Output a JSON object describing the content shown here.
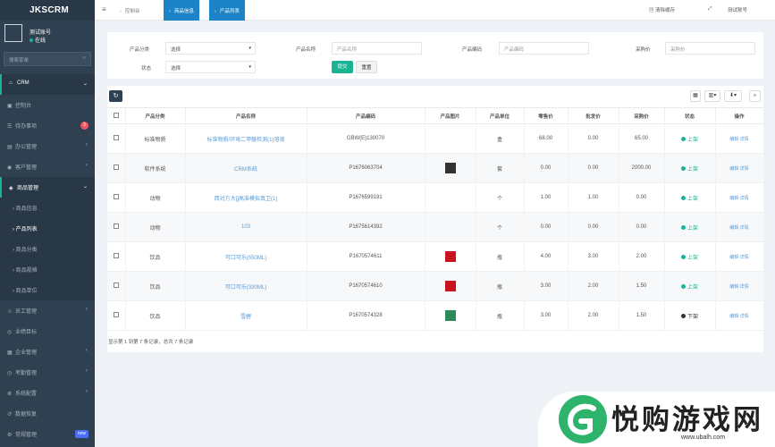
{
  "app": {
    "brand": "JKSCRM"
  },
  "user": {
    "name": "测试账号",
    "status": "在线"
  },
  "sidebar": {
    "search_placeholder": "搜索菜单",
    "items": [
      {
        "label": "CRM",
        "icon": "home-icon",
        "state": "top",
        "arrow": "⌄"
      },
      {
        "label": "控制台",
        "icon": "dashboard-icon"
      },
      {
        "label": "待办事项",
        "icon": "todo-icon",
        "badge": "3"
      },
      {
        "label": "办公管理",
        "icon": "office-icon",
        "arrow": "‹"
      },
      {
        "label": "客户管理",
        "icon": "customer-icon",
        "arrow": "‹"
      },
      {
        "label": "商品管理",
        "icon": "product-icon",
        "state": "open",
        "arrow": "⌄"
      }
    ],
    "sub_items": [
      "商品信息",
      "产品列表",
      "商品分类",
      "商品规格",
      "商品单位"
    ],
    "sub_active": 1,
    "items_after": [
      {
        "label": "员工管理",
        "icon": "staff-icon",
        "arrow": "‹"
      },
      {
        "label": "业绩目标",
        "icon": "target-icon"
      },
      {
        "label": "企业管理",
        "icon": "company-icon",
        "arrow": "‹"
      },
      {
        "label": "考勤管理",
        "icon": "attendance-icon",
        "arrow": "‹"
      },
      {
        "label": "系统配置",
        "icon": "settings-icon",
        "arrow": "‹"
      },
      {
        "label": "数据恢复",
        "icon": "restore-icon"
      },
      {
        "label": "常规管理",
        "icon": "gear-icon",
        "badge": "new"
      }
    ]
  },
  "topbar": {
    "breadcrumbs": [
      "控制台",
      "商品信息",
      "产品列表"
    ],
    "clear_cache": "清除缓存",
    "account": "测试账号"
  },
  "filter": {
    "category_label": "产品分类",
    "category_value": "选择",
    "name_label": "产品名称",
    "name_placeholder": "产品名称",
    "code_label": "产品编码",
    "code_placeholder": "产品编码",
    "price_label": "采购价",
    "price_placeholder": "采购价",
    "status_label": "状态",
    "status_value": "选择",
    "submit": "提交",
    "reset": "重置"
  },
  "table": {
    "headers": [
      "产品分类",
      "产品名称",
      "产品编码",
      "产品图片",
      "产品单位",
      "零售价",
      "批发价",
      "采购价",
      "状态",
      "操作"
    ],
    "rows": [
      {
        "category": "标准物质",
        "name": "标准物质/环境二甲醚检测(1)溶液",
        "code": "GBW(E)130070",
        "img": "",
        "unit": "盒",
        "retail": "68.00",
        "wholesale": "0.00",
        "purchase": "65.00",
        "status": "上架",
        "ops": "编辑 详情"
      },
      {
        "category": "软件系统",
        "name": "CRM系统",
        "code": "P1676063704",
        "img": "dark",
        "unit": "套",
        "retail": "0.00",
        "wholesale": "0.00",
        "purchase": "2000.00",
        "status": "上架",
        "ops": "编辑 详情"
      },
      {
        "category": "动物",
        "name": "西对方大[]高准模拟真卫(1)",
        "code": "P1676599191",
        "img": "",
        "unit": "个",
        "retail": "1.00",
        "wholesale": "1.00",
        "purchase": "0.00",
        "status": "上架",
        "ops": "编辑 详情"
      },
      {
        "category": "动物",
        "name": "103",
        "code": "P1675614392",
        "img": "",
        "unit": "个",
        "retail": "0.00",
        "wholesale": "0.00",
        "purchase": "0.00",
        "status": "上架",
        "ops": "编辑 详情"
      },
      {
        "category": "饮品",
        "name": "可口可乐(550ML)",
        "code": "P1670574611",
        "img": "red",
        "unit": "瓶",
        "retail": "4.00",
        "wholesale": "3.00",
        "purchase": "2.00",
        "status": "上架",
        "ops": "编辑 详情"
      },
      {
        "category": "饮品",
        "name": "可口可乐(330ML)",
        "code": "P1670574610",
        "img": "red",
        "unit": "瓶",
        "retail": "3.00",
        "wholesale": "2.00",
        "purchase": "1.50",
        "status": "上架",
        "ops": "编辑 详情"
      },
      {
        "category": "饮品",
        "name": "雪碧",
        "code": "P1670574328",
        "img": "green",
        "unit": "瓶",
        "retail": "3.00",
        "wholesale": "2.00",
        "purchase": "1.50",
        "status": "下架",
        "ops": "编辑 详情"
      }
    ],
    "footer": "显示第 1 到第 7 条记录，总共 7 条记录"
  },
  "watermark": {
    "title": "悦购游戏网",
    "url": "www.ubalh.com"
  },
  "colors": {
    "sidebar": "#2f4050",
    "accent": "#1ab394",
    "breadcrumb_active": "#1c84c6",
    "status_on": "#1ab394",
    "status_off": "#333333"
  }
}
